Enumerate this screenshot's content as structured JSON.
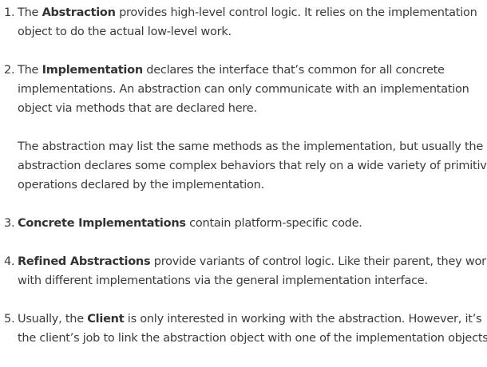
{
  "items": [
    {
      "number": "1.",
      "paragraphs": [
        [
          [
            {
              "t": "The "
            },
            {
              "t": "Abstraction",
              "b": true
            },
            {
              "t": " provides high-level control logic. It relies on the implementation"
            }
          ],
          [
            {
              "t": "object to do the actual low-level work."
            }
          ]
        ]
      ]
    },
    {
      "number": "2.",
      "paragraphs": [
        [
          [
            {
              "t": "The "
            },
            {
              "t": "Implementation",
              "b": true
            },
            {
              "t": " declares the interface that’s common for all concrete"
            }
          ],
          [
            {
              "t": "implementations. An abstraction can only communicate with an implementation"
            }
          ],
          [
            {
              "t": "object via methods that are declared here."
            }
          ]
        ],
        [
          [
            {
              "t": "The abstraction may list the same methods as the implementation, but usually the"
            }
          ],
          [
            {
              "t": "abstraction declares some complex behaviors that rely on a wide variety of primitive"
            }
          ],
          [
            {
              "t": "operations declared by the implementation."
            }
          ]
        ]
      ]
    },
    {
      "number": "3.",
      "paragraphs": [
        [
          [
            {
              "t": "Concrete Implementations",
              "b": true
            },
            {
              "t": " contain platform-specific code."
            }
          ]
        ]
      ]
    },
    {
      "number": "4.",
      "paragraphs": [
        [
          [
            {
              "t": "Refined Abstractions",
              "b": true
            },
            {
              "t": " provide variants of control logic. Like their parent, they work"
            }
          ],
          [
            {
              "t": "with different implementations via the general implementation interface."
            }
          ]
        ]
      ]
    },
    {
      "number": "5.",
      "paragraphs": [
        [
          [
            {
              "t": "Usually, the "
            },
            {
              "t": "Client",
              "b": true
            },
            {
              "t": " is only interested in working with the abstraction. However, it’s"
            }
          ],
          [
            {
              "t": "the client’s job to link the abstraction object with one of the implementation objects."
            }
          ]
        ]
      ]
    }
  ]
}
